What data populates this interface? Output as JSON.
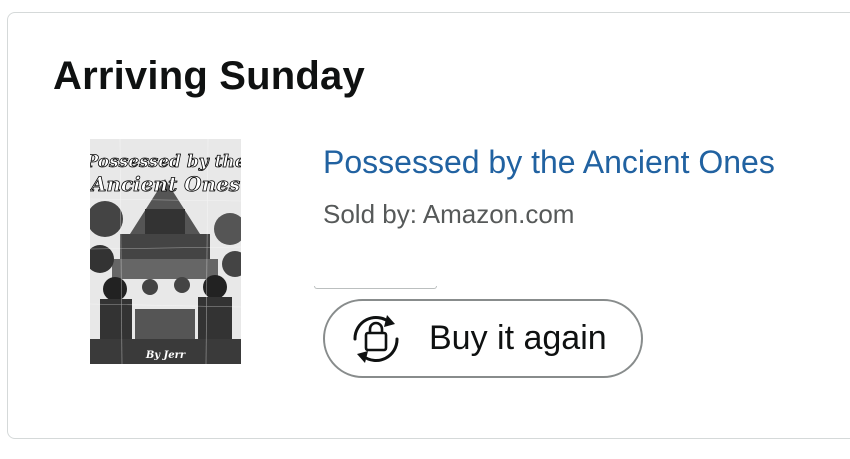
{
  "delivery": {
    "heading": "Arriving Sunday"
  },
  "item": {
    "title": "Possessed by the Ancient Ones",
    "seller": "Sold by: Amazon.com",
    "cover": {
      "title_line1": "Possessed by the",
      "title_line2": "Ancient Ones",
      "author": "By Jerr"
    }
  },
  "actions": {
    "buy_again_label": "Buy it again",
    "buy_again_icon": "buy-again-bag-cycle-icon"
  }
}
